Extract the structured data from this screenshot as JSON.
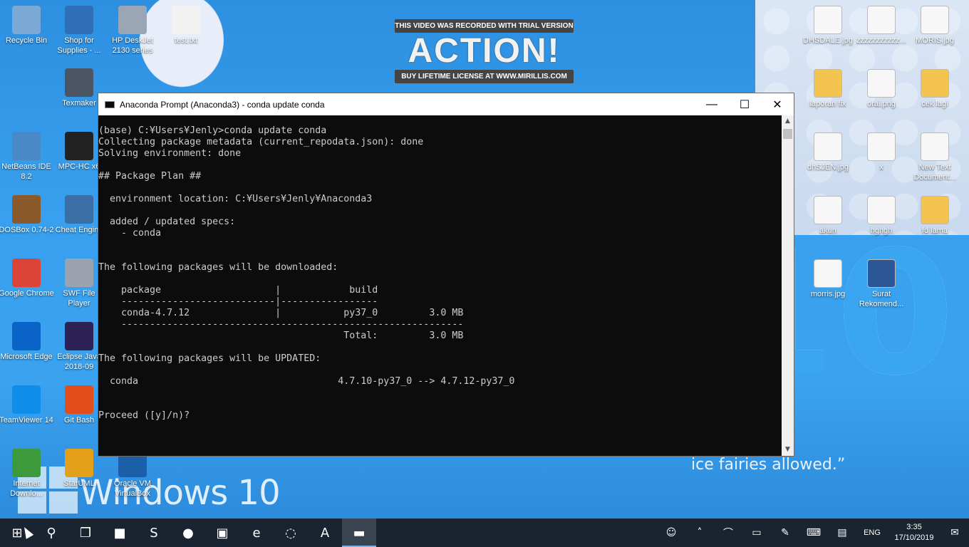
{
  "desktop": {
    "watermark": {
      "top": "THIS VIDEO WAS RECORDED WITH TRIAL VERSION",
      "logo": "ACTION!",
      "bottom": "BUY LIFETIME LICENSE AT WWW.MIRILLIS.COM"
    },
    "wallpaper_text": "Windows 10",
    "wallpaper_quote": "ice fairies allowed.”",
    "wallpaper_big": "10",
    "icons_left": [
      {
        "label": "Recycle Bin",
        "icon": "recycle-bin-icon",
        "color": "#7aa9d6"
      },
      {
        "label": "Shop for Supplies - ...",
        "icon": "shop-supplies-icon",
        "color": "#2f6fb8"
      },
      {
        "label": "HP DeskJet 2130 series",
        "icon": "printer-icon",
        "color": "#9aa6b5"
      },
      {
        "label": "test.txt",
        "icon": "text-file-icon",
        "color": "#f2f2f2"
      },
      {
        "label": "Texmaker",
        "icon": "texmaker-icon",
        "color": "#4b5563"
      },
      {
        "label": "NetBeans IDE 8.2",
        "icon": "netbeans-icon",
        "color": "#4a89c8"
      },
      {
        "label": "MPC-HC x6",
        "icon": "mpc-hc-icon",
        "color": "#222"
      },
      {
        "label": "DOSBox 0.74-2",
        "icon": "dosbox-icon",
        "color": "#8b5a2b"
      },
      {
        "label": "Cheat Engine",
        "icon": "cheat-engine-icon",
        "color": "#3b6ea5"
      },
      {
        "label": "Google Chrome",
        "icon": "chrome-icon",
        "color": "#db4437"
      },
      {
        "label": "SWF File Player",
        "icon": "swf-player-icon",
        "color": "#9ca3af"
      },
      {
        "label": "Microsoft Edge",
        "icon": "edge-icon",
        "color": "#0a64c8"
      },
      {
        "label": "Eclipse Java 2018-09",
        "icon": "eclipse-icon",
        "color": "#2c2255"
      },
      {
        "label": "TeamViewer 14",
        "icon": "teamviewer-icon",
        "color": "#0e8ee9"
      },
      {
        "label": "Git Bash",
        "icon": "git-bash-icon",
        "color": "#e24e1b"
      },
      {
        "label": "Internet Downlo...",
        "icon": "idm-icon",
        "color": "#3c9a3c"
      },
      {
        "label": "StarUML",
        "icon": "staruml-icon",
        "color": "#e5a01a"
      },
      {
        "label": "Oracle VM VirtualBox",
        "icon": "virtualbox-icon",
        "color": "#1a5fa8"
      }
    ],
    "icons_right": [
      {
        "label": "DHSDALE.jpg",
        "icon": "image-file-icon"
      },
      {
        "label": "zzzzzzzzzzz...",
        "icon": "image-file-icon"
      },
      {
        "label": "MORIS.jpg",
        "icon": "image-file-icon"
      },
      {
        "label": "laporan fix",
        "icon": "folder-icon"
      },
      {
        "label": "orai.png",
        "icon": "image-file-icon"
      },
      {
        "label": "cek lagi",
        "icon": "folder-icon"
      },
      {
        "label": "dhSJEN.jpg",
        "icon": "image-file-icon"
      },
      {
        "label": "x",
        "icon": "blank-file-icon"
      },
      {
        "label": "New Text Document...",
        "icon": "text-file-icon"
      },
      {
        "label": "akun",
        "icon": "blank-file-icon"
      },
      {
        "label": "hghgh",
        "icon": "blank-file-icon"
      },
      {
        "label": "fd lama",
        "icon": "folder-icon"
      },
      {
        "label": "morris.jpg",
        "icon": "image-file-icon"
      },
      {
        "label": "Surat Rekomend...",
        "icon": "word-document-icon"
      }
    ]
  },
  "window": {
    "title": "Anaconda Prompt (Anaconda3) - conda  update conda",
    "minimize": "—",
    "maximize": "☐",
    "close": "✕",
    "console_lines": [
      "(base) C:¥Users¥Jenly>conda update conda",
      "Collecting package metadata (current_repodata.json): done",
      "Solving environment: done",
      "",
      "## Package Plan ##",
      "",
      "  environment location: C:¥Users¥Jenly¥Anaconda3",
      "",
      "  added / updated specs:",
      "    - conda",
      "",
      "",
      "The following packages will be downloaded:",
      "",
      "    package                    |            build",
      "    ---------------------------|-----------------",
      "    conda-4.7.12               |           py37_0         3.0 MB",
      "    ------------------------------------------------------------",
      "                                           Total:         3.0 MB",
      "",
      "The following packages will be UPDATED:",
      "",
      "  conda                                   4.7.10-py37_0 --> 4.7.12-py37_0",
      "",
      "",
      "Proceed ([y]/n)?"
    ]
  },
  "taskbar": {
    "items": [
      {
        "name": "start-button",
        "glyph": "⊞"
      },
      {
        "name": "search-button",
        "glyph": "⚲"
      },
      {
        "name": "task-view-button",
        "glyph": "❐"
      },
      {
        "name": "file-explorer",
        "glyph": "■"
      },
      {
        "name": "sublime-text",
        "glyph": "S"
      },
      {
        "name": "chrome",
        "glyph": "●"
      },
      {
        "name": "mpc-hc",
        "glyph": "▣"
      },
      {
        "name": "edge",
        "glyph": "e"
      },
      {
        "name": "spinner-app",
        "glyph": "◌"
      },
      {
        "name": "action-recorder",
        "glyph": "A"
      },
      {
        "name": "anaconda-prompt",
        "glyph": "▬"
      }
    ],
    "tray": {
      "people": "☺",
      "chevron": "˄",
      "wifi": "⌒",
      "battery": "▭",
      "pen": "✎",
      "keyboard": "⌨",
      "tablet": "▤",
      "language": "ENG",
      "time": "3:35",
      "date": "17/10/2019",
      "notifications": "✉"
    }
  }
}
